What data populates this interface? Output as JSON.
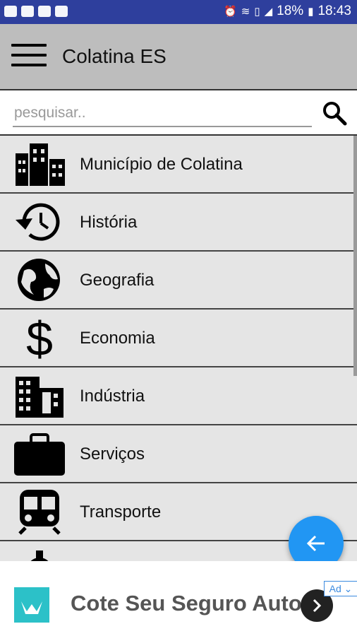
{
  "status_bar": {
    "battery": "18%",
    "time": "18:43",
    "left_icons": [
      "youtube-icon",
      "youtube-icon",
      "image-icon",
      "gallery-icon"
    ],
    "right_icons": [
      "alarm-icon",
      "wifi-icon",
      "vibrate-icon",
      "signal-icon",
      "battery-icon"
    ]
  },
  "app_bar": {
    "title": "Colatina ES",
    "menu_icon": "hamburger-menu-icon"
  },
  "search": {
    "placeholder": "pesquisar..",
    "value": "",
    "icon": "search-icon"
  },
  "menu_items": [
    {
      "label": "Município de Colatina",
      "icon": "city-buildings-icon"
    },
    {
      "label": "História",
      "icon": "history-clock-icon"
    },
    {
      "label": "Geografia",
      "icon": "globe-icon"
    },
    {
      "label": "Economia",
      "icon": "dollar-icon"
    },
    {
      "label": "Indústria",
      "icon": "industry-building-icon"
    },
    {
      "label": "Serviços",
      "icon": "briefcase-icon"
    },
    {
      "label": "Transporte",
      "icon": "train-icon"
    },
    {
      "label": "",
      "icon": "gear-icon"
    }
  ],
  "fab": {
    "icon": "arrow-back-icon"
  },
  "ad": {
    "text": "Cote Seu Seguro Auto",
    "badge": "Ad",
    "logo_color": "#2cc1c8"
  },
  "colors": {
    "status_bar": "#2e3f9d",
    "app_bar": "#bdbdbd",
    "list_bg": "#e5e5e5",
    "fab": "#2196f3"
  }
}
